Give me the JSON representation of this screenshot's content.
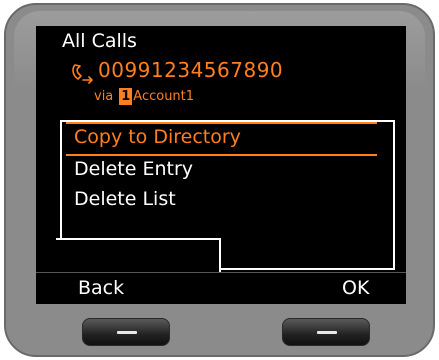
{
  "screen": {
    "title": "All Calls",
    "call": {
      "number": "00991234567890",
      "via_label": "via",
      "account_number": "1",
      "account_name": "Account1"
    },
    "menu": {
      "items": [
        {
          "label": "Copy to Directory",
          "selected": true
        },
        {
          "label": "Delete Entry",
          "selected": false
        },
        {
          "label": "Delete List",
          "selected": false
        }
      ]
    },
    "softkeys": {
      "left": "Back",
      "right": "OK"
    }
  },
  "colors": {
    "accent": "#ff7f1f",
    "screen_bg": "#000000",
    "text": "#ffffff",
    "bezel": "#8b8b8b"
  },
  "icons": {
    "call_type": "outgoing-call-icon",
    "left_button": "left-softkey-button",
    "right_button": "right-softkey-button"
  }
}
